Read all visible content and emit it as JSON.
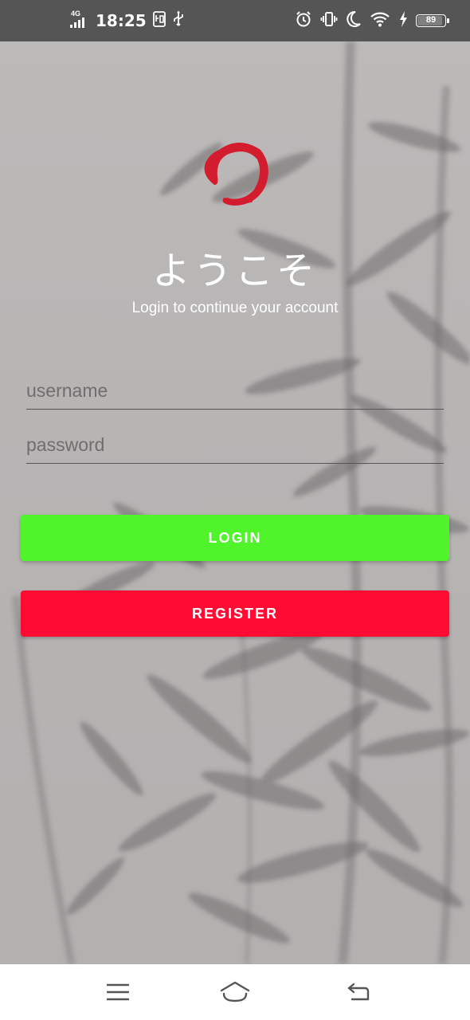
{
  "status_bar": {
    "network": "4G",
    "time": "18:25",
    "battery": "89",
    "icons": [
      "signal-icon",
      "notification-icon",
      "usb-icon",
      "alarm-icon",
      "vibrate-icon",
      "moon-icon",
      "wifi-icon",
      "charging-icon",
      "battery-icon"
    ]
  },
  "login": {
    "logo": "enso-circle-logo",
    "title": "ようこそ",
    "subtitle": "Login to continue your account",
    "username_placeholder": "username",
    "password_placeholder": "password",
    "login_label": "LOGIN",
    "register_label": "REGISTER"
  },
  "nav_bar": {
    "icons": [
      "menu-icon",
      "home-icon",
      "back-icon"
    ]
  },
  "colors": {
    "status_bar": "#555555",
    "background": "#b9b6b6",
    "login_button": "#4ff42b",
    "register_button": "#ff0b33",
    "logo": "#d31c2e",
    "text": "#ffffff"
  }
}
